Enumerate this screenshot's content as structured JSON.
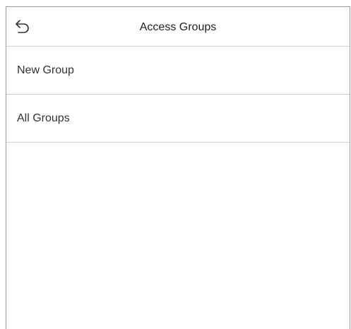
{
  "header": {
    "title": "Access Groups",
    "back_icon": "undo-arrow-icon"
  },
  "menu": {
    "items": [
      {
        "label": "New Group"
      },
      {
        "label": "All Groups"
      }
    ]
  },
  "colors": {
    "background": "#ffffff",
    "divider": "#cfcfcf",
    "frame": "#9a9a9a",
    "text": "#333333"
  }
}
